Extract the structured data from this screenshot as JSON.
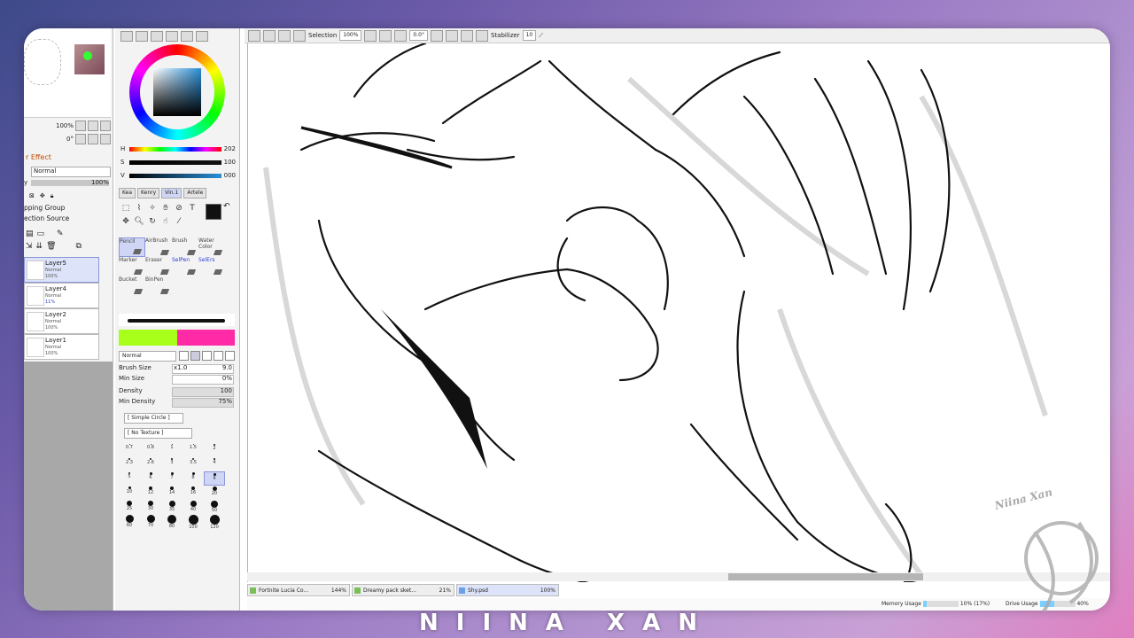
{
  "footer_title": "NIINA XAN",
  "watermark": "Niina Xan",
  "layers_panel": {
    "zoom": "100%",
    "angle": "0°",
    "effect_label": "r Effect",
    "blend_mode": "Normal",
    "opacity_label": "y",
    "opacity_value": "100%",
    "clipping_label": "pping Group",
    "selection_source_label": "ection Source",
    "layers": [
      {
        "name": "Layer5",
        "mode": "Normal",
        "opacity": "100%"
      },
      {
        "name": "Layer4",
        "mode": "Normal",
        "opacity": "11%"
      },
      {
        "name": "Layer2",
        "mode": "Normal",
        "opacity": "100%"
      },
      {
        "name": "Layer1",
        "mode": "Normal",
        "opacity": "100%"
      }
    ]
  },
  "color_panel": {
    "h_label": "H",
    "h_value": "202",
    "s_label": "S",
    "s_value": "100",
    "v_label": "V",
    "v_value": "000",
    "tabs": [
      "Kea",
      "Kenry",
      "Vin.1",
      "Artele"
    ],
    "primary_color": "#111111",
    "swatch_a": "#a7ff1a",
    "swatch_b": "#ff2ba6"
  },
  "brushes": [
    {
      "name": "Pencil",
      "selected": true
    },
    {
      "name": "AirBrush"
    },
    {
      "name": "Brush"
    },
    {
      "name": "Water Color"
    },
    {
      "name": "Marker"
    },
    {
      "name": "Eraser"
    },
    {
      "name": "SelPen",
      "blue": true
    },
    {
      "name": "SelErs",
      "blue": true
    },
    {
      "name": "Bucket"
    },
    {
      "name": "BinPen"
    }
  ],
  "brush_props": {
    "mode": "Normal",
    "brush_size_label": "Brush Size",
    "brush_size_mult": "x1.0",
    "brush_size_value": "9.0",
    "min_size_label": "Min Size",
    "min_size_value": "0%",
    "density_label": "Density",
    "density_value": "100",
    "min_density_label": "Min Density",
    "min_density_value": "75%",
    "shape": "[ Simple Circle ]",
    "texture": "[ No Texture ]"
  },
  "sizes": [
    "0.7",
    "0.8",
    "1",
    "1.5",
    "2",
    "2.3",
    "2.6",
    "3",
    "3.5",
    "4",
    "5",
    "6",
    "7",
    "8",
    "9",
    "10",
    "12",
    "14",
    "16",
    "20",
    "25",
    "30",
    "35",
    "40",
    "50",
    "60",
    "70",
    "80",
    "100",
    "120"
  ],
  "toolbar": {
    "selection_label": "Selection",
    "zoom": "100%",
    "angle": "0.0°",
    "stabilizer_label": "Stabilizer",
    "stabilizer_value": "10"
  },
  "doc_tabs": [
    {
      "name": "Fortnite Lucia Co...",
      "pct": "144%"
    },
    {
      "name": "Dreamy pack sket...",
      "pct": "21%"
    },
    {
      "name": "Shy.psd",
      "pct": "100%",
      "active": true
    }
  ],
  "status": {
    "memory_label": "Memory Usage",
    "memory_value": "10% (17%)",
    "drive_label": "Drive Usage",
    "drive_value": "40%"
  }
}
